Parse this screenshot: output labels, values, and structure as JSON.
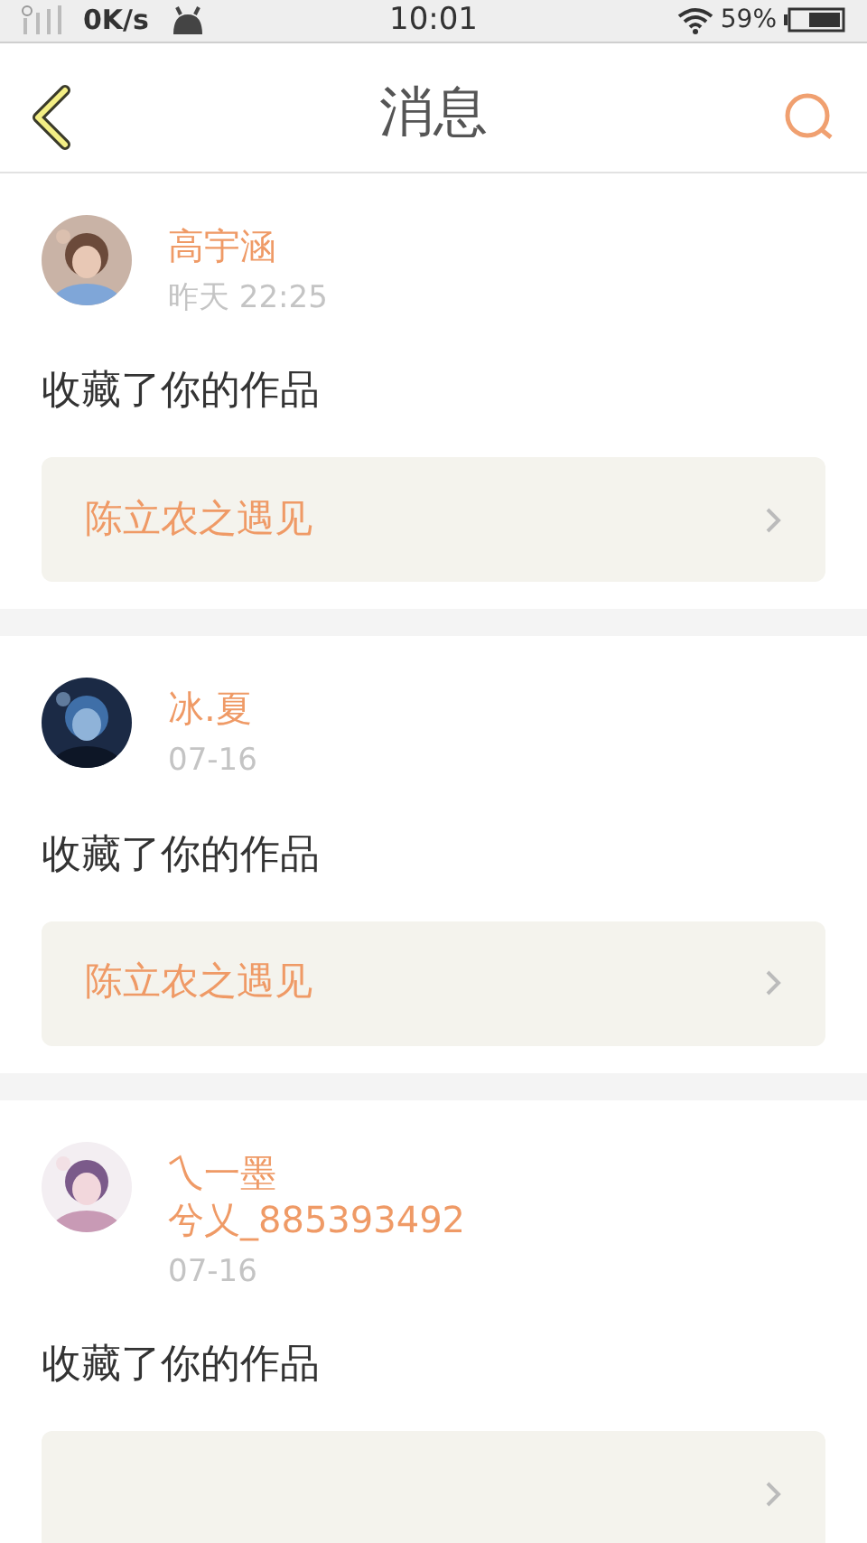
{
  "status_bar": {
    "speed": "0K/s",
    "time": "10:01",
    "battery": "59%"
  },
  "header": {
    "title": "消息"
  },
  "messages": [
    {
      "name_lines": [
        "高宇涵"
      ],
      "time": "昨天 22:25",
      "action": "收藏了你的作品",
      "work": "陈立农之遇见",
      "avatar": {
        "kind": "picture"
      }
    },
    {
      "name_lines": [
        "冰.夏"
      ],
      "time": "07-16",
      "action": "收藏了你的作品",
      "work": "陈立农之遇见",
      "avatar": {
        "kind": "picture"
      }
    },
    {
      "name_lines": [
        "乀一墨",
        "兮乂_885393492"
      ],
      "time": "07-16",
      "action": "收藏了你的作品",
      "avatar": {
        "kind": "picture"
      }
    }
  ]
}
